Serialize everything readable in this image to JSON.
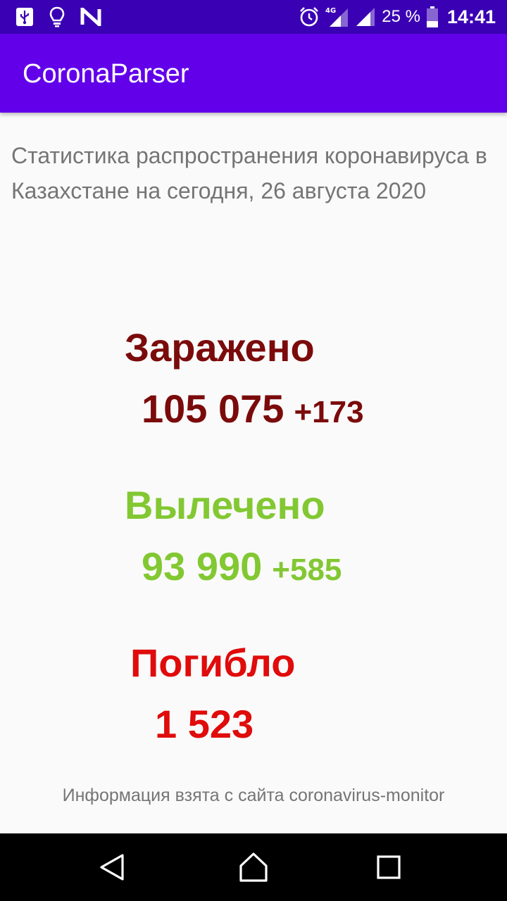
{
  "status_bar": {
    "battery_percent": "25 %",
    "time": "14:41",
    "network_type": "4G",
    "icons": [
      "usb-icon",
      "lightbulb-icon",
      "n-app-icon",
      "alarm-icon",
      "signal-4g-icon",
      "signal-icon",
      "battery-icon"
    ]
  },
  "app_bar": {
    "title": "CoronaParser"
  },
  "main": {
    "intro_text": "Статистика распространения коронавируса в Казахстане на сегодня, 26 августа 2020",
    "infected": {
      "label": "Заражено",
      "value": "105 075",
      "delta": "+173",
      "color": "#7b0b0b"
    },
    "recovered": {
      "label": "Вылечено",
      "value": "93 990",
      "delta": "+585",
      "color": "#82c832"
    },
    "died": {
      "label": "Погибло",
      "value": "1 523",
      "color": "#e00b0b"
    },
    "source_note": "Информация взята с сайта coronavirus-monitor"
  },
  "nav_bar": {
    "buttons": [
      "back-icon",
      "home-icon",
      "recents-icon"
    ]
  },
  "colors": {
    "status_bar": "#3a00b4",
    "app_bar": "#6200ea",
    "background": "#fafafa",
    "secondary_text": "#757575"
  }
}
